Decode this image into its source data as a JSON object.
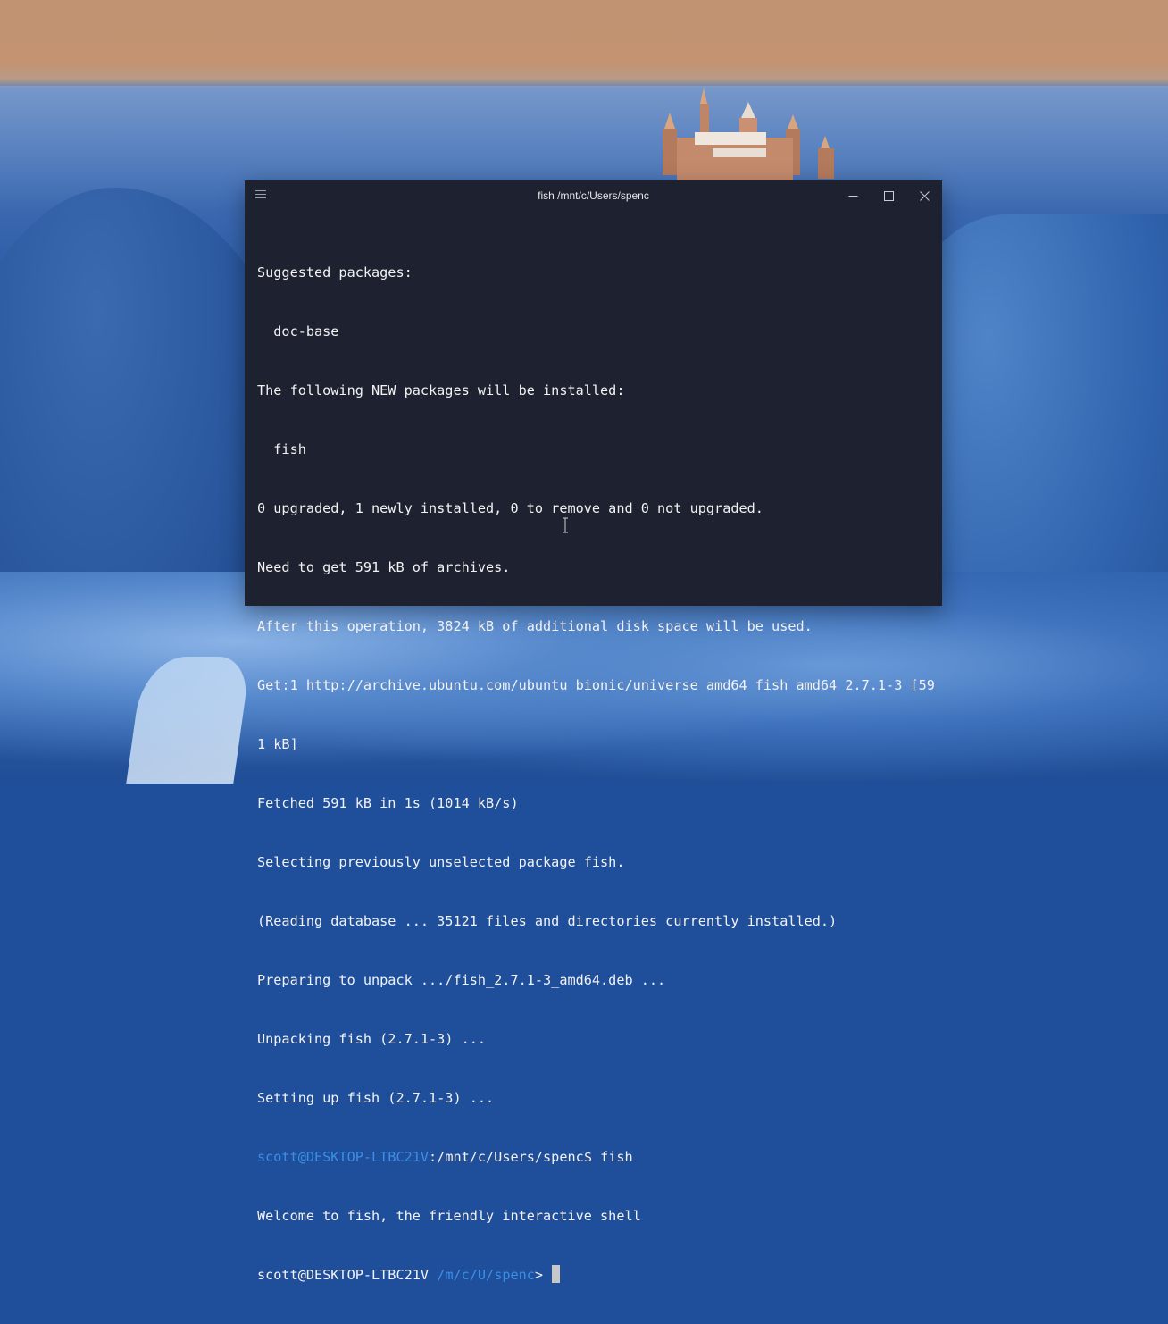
{
  "window": {
    "title": "fish /mnt/c/Users/spenc"
  },
  "terminal": {
    "lines": [
      "Suggested packages:",
      "  doc-base",
      "The following NEW packages will be installed:",
      "  fish",
      "0 upgraded, 1 newly installed, 0 to remove and 0 not upgraded.",
      "Need to get 591 kB of archives.",
      "After this operation, 3824 kB of additional disk space will be used.",
      "Get:1 http://archive.ubuntu.com/ubuntu bionic/universe amd64 fish amd64 2.7.1-3 [59",
      "1 kB]",
      "Fetched 591 kB in 1s (1014 kB/s)",
      "Selecting previously unselected package fish.",
      "(Reading database ... 35121 files and directories currently installed.)",
      "Preparing to unpack .../fish_2.7.1-3_amd64.deb ...",
      "Unpacking fish (2.7.1-3) ...",
      "Setting up fish (2.7.1-3) ..."
    ],
    "bash_prompt": {
      "user_host": "scott@DESKTOP-LTBC21V",
      "path": ":/mnt/c/Users/spenc",
      "symbol": "$ ",
      "command": "fish"
    },
    "welcome": "Welcome to fish, the friendly interactive shell",
    "fish_prompt": {
      "user_host": "scott@DESKTOP-LTBC21V",
      "path": "/m/c/U/spenc",
      "symbol": "> "
    }
  },
  "colors": {
    "terminal_bg": "#1e2230",
    "text": "#f2f2f2",
    "prompt_path": "#3b8ee6"
  },
  "icons": {
    "menu": "hamburger-icon",
    "minimize": "minimize-icon",
    "maximize": "maximize-icon",
    "close": "close-icon",
    "text_cursor": "ibeam-cursor-icon"
  }
}
